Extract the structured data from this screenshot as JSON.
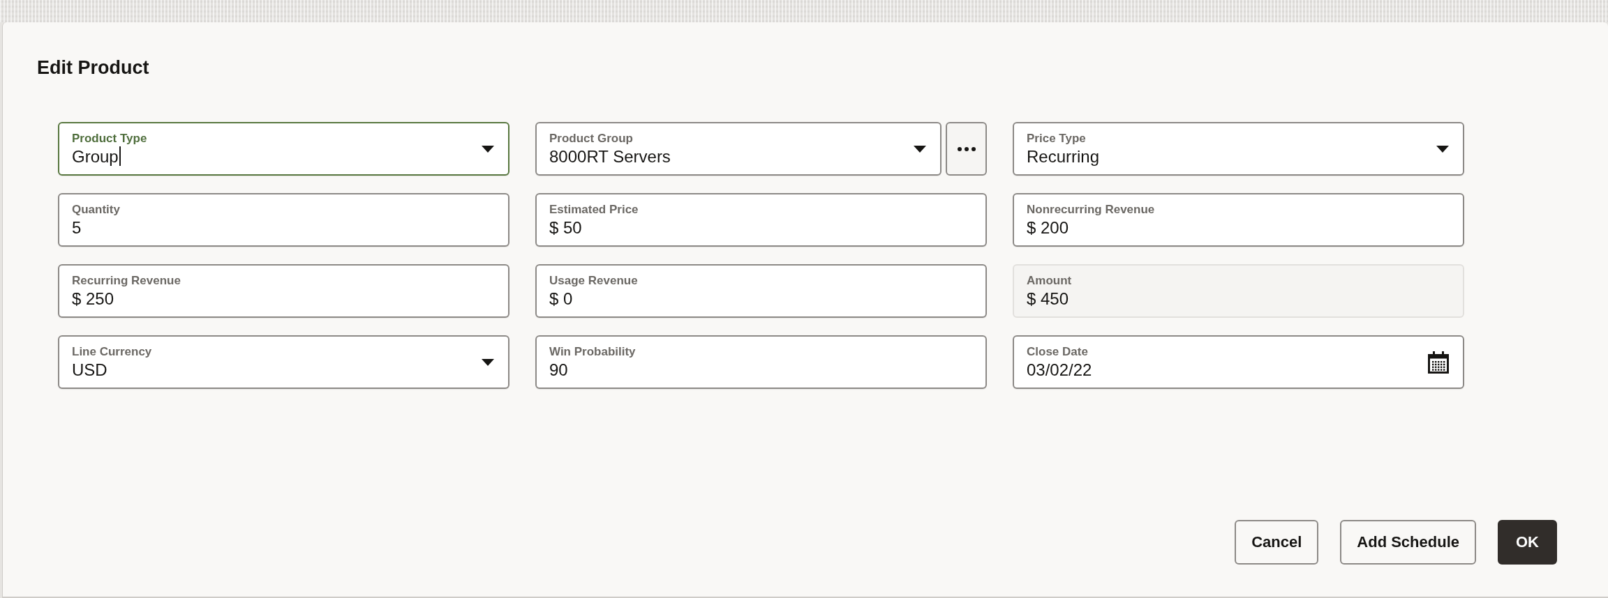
{
  "dialog": {
    "title": "Edit Product"
  },
  "fields": [
    {
      "kind": "select",
      "label": "Product Type",
      "value": "Group",
      "focused": true
    },
    {
      "kind": "lookup",
      "label": "Product Group",
      "value": "8000RT Servers",
      "focused": false
    },
    {
      "kind": "select",
      "label": "Price Type",
      "value": "Recurring",
      "focused": false
    },
    {
      "kind": "text",
      "label": "Quantity",
      "value": "5",
      "focused": false
    },
    {
      "kind": "text",
      "label": "Estimated Price",
      "value": "$ 50",
      "focused": false
    },
    {
      "kind": "text",
      "label": "Nonrecurring Revenue",
      "value": "$ 200",
      "focused": false
    },
    {
      "kind": "text",
      "label": "Recurring Revenue",
      "value": "$ 250",
      "focused": false
    },
    {
      "kind": "text",
      "label": "Usage Revenue",
      "value": "$ 0",
      "focused": false
    },
    {
      "kind": "readonly",
      "label": "Amount",
      "value": "$ 450",
      "focused": false
    },
    {
      "kind": "select",
      "label": "Line Currency",
      "value": "USD",
      "focused": false
    },
    {
      "kind": "text",
      "label": "Win Probability",
      "value": "90",
      "focused": false
    },
    {
      "kind": "date",
      "label": "Close Date",
      "value": "03/02/22",
      "focused": false
    }
  ],
  "buttons": [
    {
      "kind": "secondary",
      "label": "Cancel"
    },
    {
      "kind": "secondary",
      "label": "Add Schedule"
    },
    {
      "kind": "primary",
      "label": "OK"
    }
  ]
}
